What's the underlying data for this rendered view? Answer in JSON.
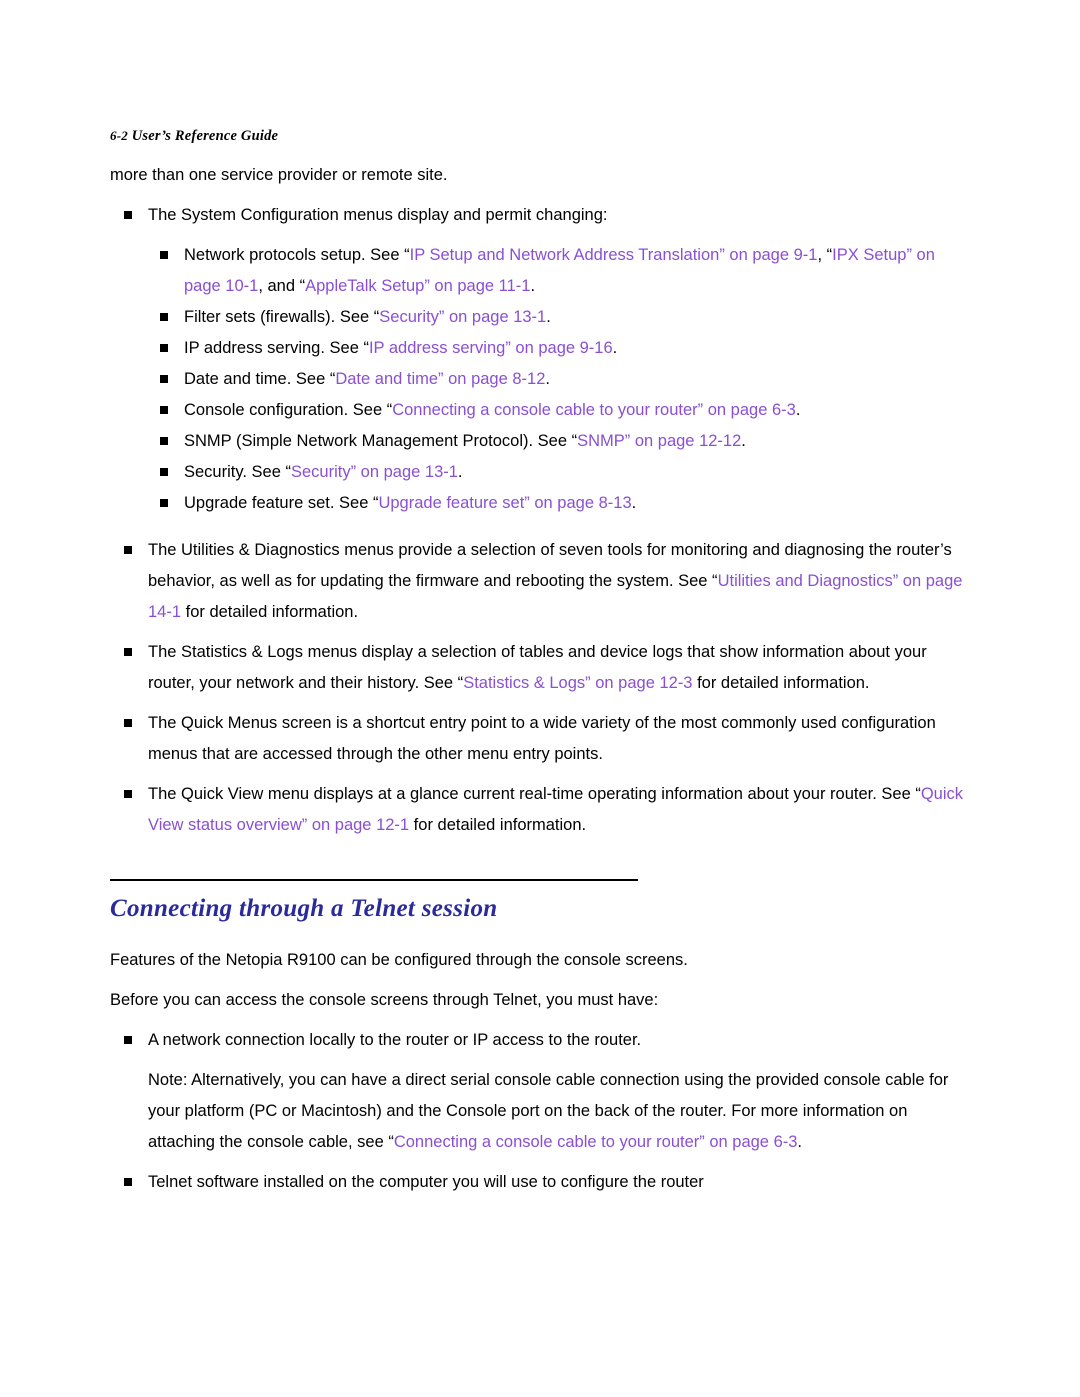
{
  "header": {
    "page_number": "6-2",
    "title": "User’s Reference Guide"
  },
  "intro": {
    "line1": "more than one service provider or remote site."
  },
  "bullets_top": {
    "b1": "The System Configuration menus display and permit changing:"
  },
  "sub_bullets": [
    {
      "pre": "Network protocols setup. See “",
      "link1": "IP Setup and Network Address Translation” on page 9-1",
      "mid": ", “",
      "link2": "IPX Setup” on page 10-1",
      "mid2": ", and “",
      "link3": "AppleTalk Setup” on page 11-1",
      "post": "."
    },
    {
      "pre": "Filter sets (firewalls). See “",
      "link1": "Security” on page 13-1",
      "post": "."
    },
    {
      "pre": "IP address serving. See “",
      "link1": "IP address serving” on page 9-16",
      "post": "."
    },
    {
      "pre": "Date and time. See “",
      "link1": "Date and time” on page 8-12",
      "post": "."
    },
    {
      "pre": "Console configuration. See “",
      "link1": "Connecting a console cable to your router” on page 6-3",
      "post": "."
    },
    {
      "pre": "SNMP (Simple Network Management Protocol). See “",
      "link1": "SNMP” on page 12-12",
      "post": "."
    },
    {
      "pre": "Security. See “",
      "link1": "Security” on page 13-1",
      "post": "."
    },
    {
      "pre": "Upgrade feature set. See “",
      "link1": "Upgrade feature set” on page 8-13",
      "post": "."
    }
  ],
  "paragraphs": [
    {
      "pre": "The Utilities & Diagnostics menus provide a selection of seven tools for monitoring and diagnosing the router’s behavior, as well as for updating the firmware and rebooting the system. See “",
      "link": "Utilities and Diagnostics” on page 14-1",
      "post": " for detailed information."
    },
    {
      "pre": "The Statistics & Logs menus display a selection of tables and device logs that show information about your router, your network and their history. See “",
      "link": "Statistics & Logs” on page 12-3",
      "post": " for detailed information."
    },
    {
      "pre": "The Quick Menus screen is a shortcut entry point to a wide variety of the most commonly used configuration menus that are accessed through the other menu entry points.",
      "link": "",
      "post": ""
    },
    {
      "pre": "The Quick View menu displays at a glance current real-time operating information about your router. See “",
      "link": "Quick View status overview” on page 12-1",
      "post": " for detailed information."
    }
  ],
  "section": {
    "heading": "Connecting through a Telnet session",
    "para1": "Features of the Netopia R9100 can be configured through the console screens.",
    "para2": "Before you can access the console screens through Telnet, you must have:",
    "bullet1": "A network connection locally to the router or IP access to the router.",
    "note_pre": "Note: Alternatively, you can have a direct serial console cable connection using the provided console cable for your platform (PC or Macintosh) and the Console port on the back of the router. For more information on attaching the console cable, see “",
    "note_link": "Connecting a console cable to your router” on page 6-3",
    "note_post": ".",
    "bullet2": "Telnet software installed on the computer you will use to configure the router"
  }
}
